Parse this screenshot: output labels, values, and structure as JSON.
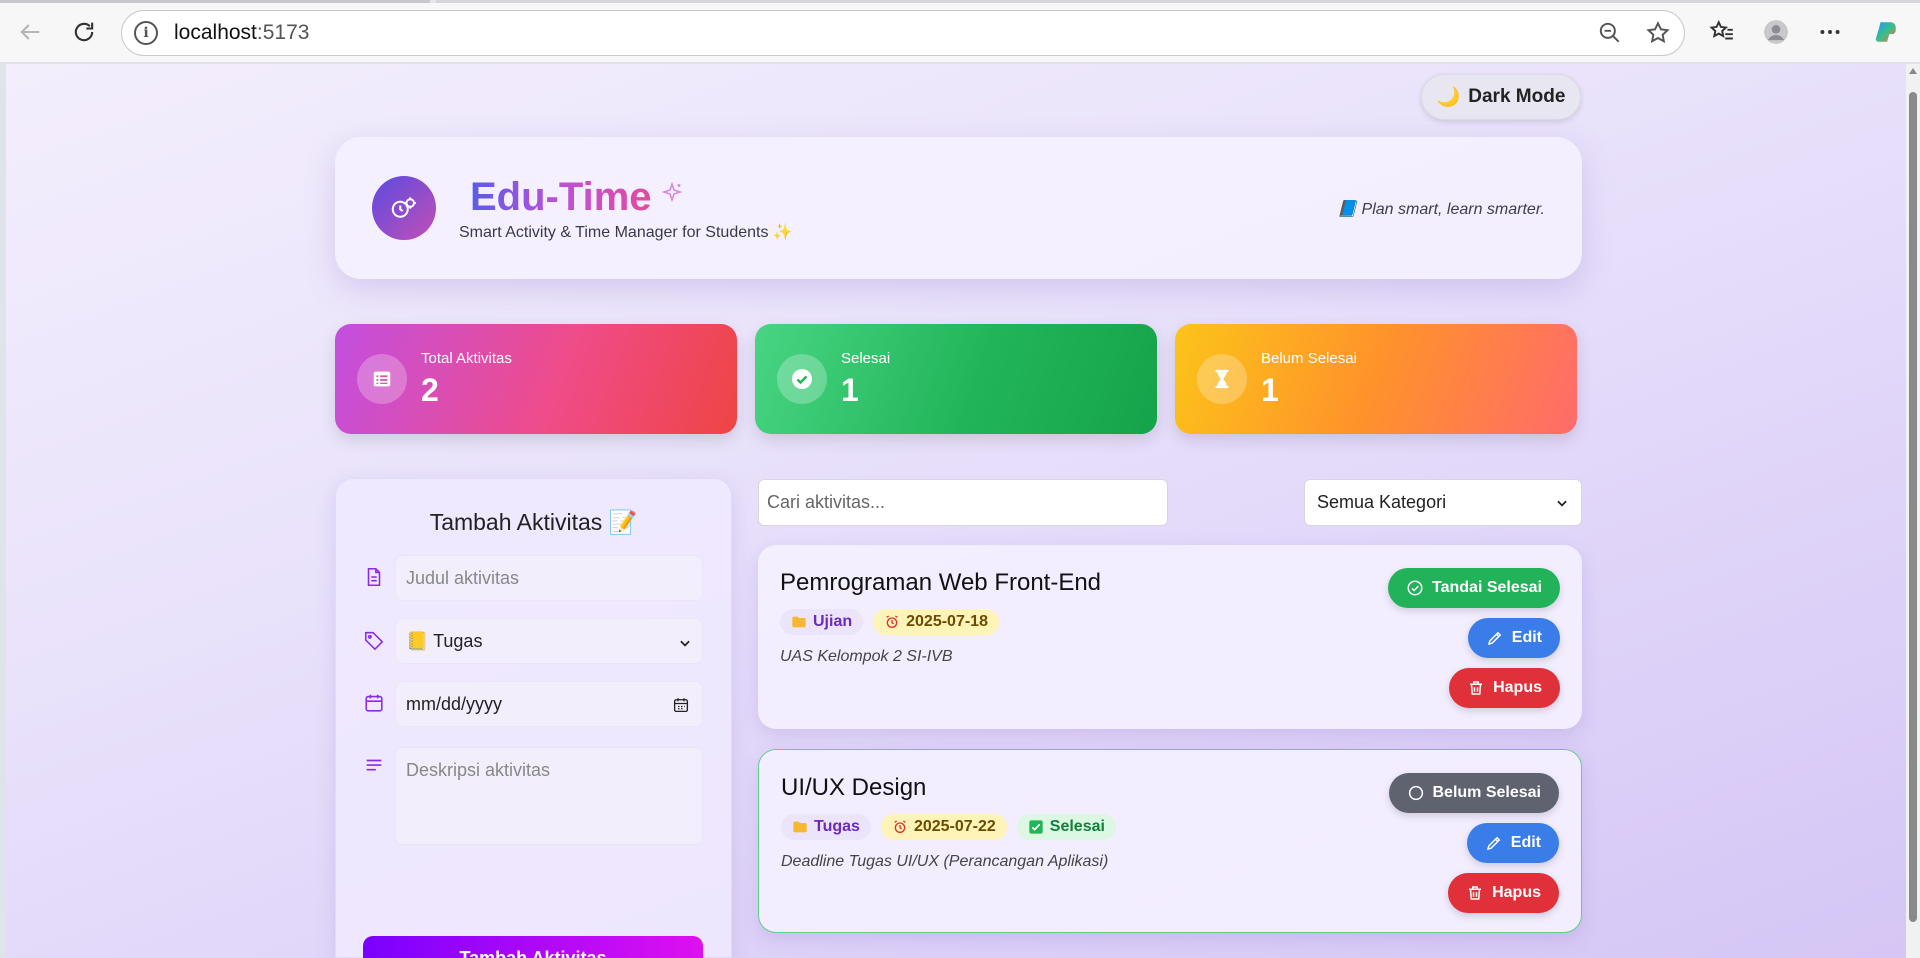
{
  "browser": {
    "url_host": "localhost",
    "url_port": ":5173"
  },
  "page": {
    "dark_mode_label": "Dark Mode",
    "dark_mode_emoji": "🌙"
  },
  "header": {
    "brand": "Edu-Time",
    "tagline": "Smart Activity & Time Manager for Students ✨",
    "motto": "📘 Plan smart, learn smarter."
  },
  "stats": [
    {
      "label": "Total Aktivitas",
      "value": "2",
      "icon": "list-icon",
      "gradient": [
        "#c24fe0",
        "#ef4a4a"
      ]
    },
    {
      "label": "Selesai",
      "value": "1",
      "icon": "check-circle-icon",
      "gradient": [
        "#43d07a",
        "#17a34a"
      ]
    },
    {
      "label": "Belum Selesai",
      "value": "1",
      "icon": "hourglass-icon",
      "gradient": [
        "#fcc419",
        "#ff6b6b"
      ]
    }
  ],
  "form": {
    "title": "Tambah Aktivitas 📝",
    "title_placeholder": "Judul aktivitas",
    "category_value": "📒 Tugas",
    "date_placeholder": "mm/dd/yyyy",
    "description_placeholder": "Deskripsi aktivitas",
    "submit_label": "Tambah Aktivitas"
  },
  "filter": {
    "search_placeholder": "Cari aktivitas...",
    "category_value": "Semua Kategori"
  },
  "activities": [
    {
      "title": "Pemrograman Web Front-End",
      "category": "Ujian",
      "date": "2025-07-18",
      "description": "UAS Kelompok 2 SI-IVB",
      "status_button": "Tandai Selesai",
      "completed": false,
      "edit_label": "Edit",
      "delete_label": "Hapus"
    },
    {
      "title": "UI/UX Design",
      "category": "Tugas",
      "date": "2025-07-22",
      "description": "Deadline Tugas UI/UX (Perancangan Aplikasi)",
      "status_button": "Belum Selesai",
      "done_badge": "Selesai",
      "completed": true,
      "edit_label": "Edit",
      "delete_label": "Hapus"
    }
  ]
}
